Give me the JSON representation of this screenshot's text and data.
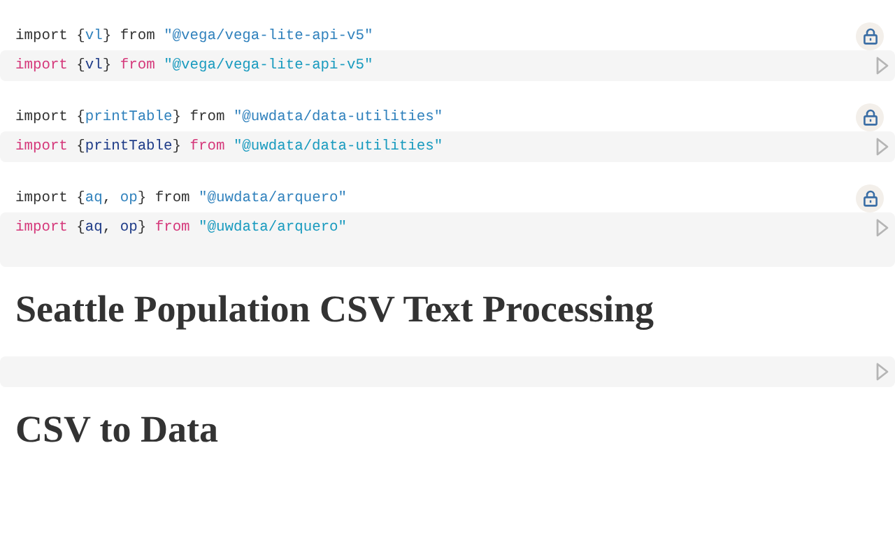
{
  "cells": [
    {
      "kind": "import",
      "output": [
        {
          "text": "import ",
          "kind": "keyword"
        },
        {
          "text": "{",
          "kind": "punct"
        },
        {
          "text": "vl",
          "kind": "name"
        },
        {
          "text": "} ",
          "kind": "punct"
        },
        {
          "text": "from ",
          "kind": "keyword"
        },
        {
          "text": "\"@vega/vega-lite-api-v5\"",
          "kind": "string"
        }
      ],
      "source": [
        {
          "text": "import ",
          "kind": "keyword"
        },
        {
          "text": "{",
          "kind": "punct"
        },
        {
          "text": "vl",
          "kind": "name"
        },
        {
          "text": "} ",
          "kind": "punct"
        },
        {
          "text": "from ",
          "kind": "keyword"
        },
        {
          "text": "\"@vega/vega-lite-api-v5\"",
          "kind": "string"
        }
      ]
    },
    {
      "kind": "import",
      "output": [
        {
          "text": "import ",
          "kind": "keyword"
        },
        {
          "text": "{",
          "kind": "punct"
        },
        {
          "text": "printTable",
          "kind": "name"
        },
        {
          "text": "} ",
          "kind": "punct"
        },
        {
          "text": "from ",
          "kind": "keyword"
        },
        {
          "text": "\"@uwdata/data-utilities\"",
          "kind": "string"
        }
      ],
      "source": [
        {
          "text": "import ",
          "kind": "keyword"
        },
        {
          "text": "{",
          "kind": "punct"
        },
        {
          "text": "printTable",
          "kind": "name"
        },
        {
          "text": "} ",
          "kind": "punct"
        },
        {
          "text": "from ",
          "kind": "keyword"
        },
        {
          "text": "\"@uwdata/data-utilities\"",
          "kind": "string"
        }
      ]
    },
    {
      "kind": "import",
      "output": [
        {
          "text": "import ",
          "kind": "keyword"
        },
        {
          "text": "{",
          "kind": "punct"
        },
        {
          "text": "aq",
          "kind": "name"
        },
        {
          "text": ", ",
          "kind": "punct"
        },
        {
          "text": "op",
          "kind": "name"
        },
        {
          "text": "} ",
          "kind": "punct"
        },
        {
          "text": "from ",
          "kind": "keyword"
        },
        {
          "text": "\"@uwdata/arquero\"",
          "kind": "string"
        }
      ],
      "source": [
        {
          "text": "import ",
          "kind": "keyword"
        },
        {
          "text": "{",
          "kind": "punct"
        },
        {
          "text": "aq",
          "kind": "name"
        },
        {
          "text": ", ",
          "kind": "punct"
        },
        {
          "text": "op",
          "kind": "name"
        },
        {
          "text": "} ",
          "kind": "punct"
        },
        {
          "text": "from ",
          "kind": "keyword"
        },
        {
          "text": "\"@uwdata/arquero\"",
          "kind": "string"
        }
      ]
    },
    {
      "kind": "heading",
      "text": "Seattle Population CSV Text Processing"
    },
    {
      "kind": "empty"
    },
    {
      "kind": "heading",
      "text": "CSV to Data"
    }
  ]
}
